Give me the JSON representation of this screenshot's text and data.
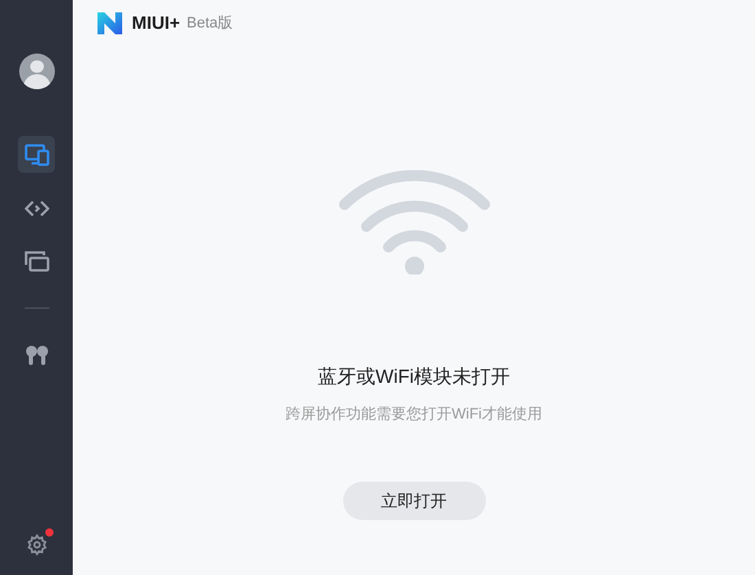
{
  "header": {
    "app_name": "MIUI+",
    "badge": "Beta版"
  },
  "sidebar": {
    "items": [
      {
        "kind": "devices",
        "selected": true
      },
      {
        "kind": "relay",
        "selected": false
      },
      {
        "kind": "screen",
        "selected": false
      },
      {
        "kind": "divider"
      },
      {
        "kind": "earbuds",
        "selected": false
      }
    ],
    "settings": {
      "notification": true
    }
  },
  "content": {
    "title": "蓝牙或WiFi模块未打开",
    "message": "跨屏协作功能需要您打开WiFi才能使用",
    "button": "立即打开"
  }
}
